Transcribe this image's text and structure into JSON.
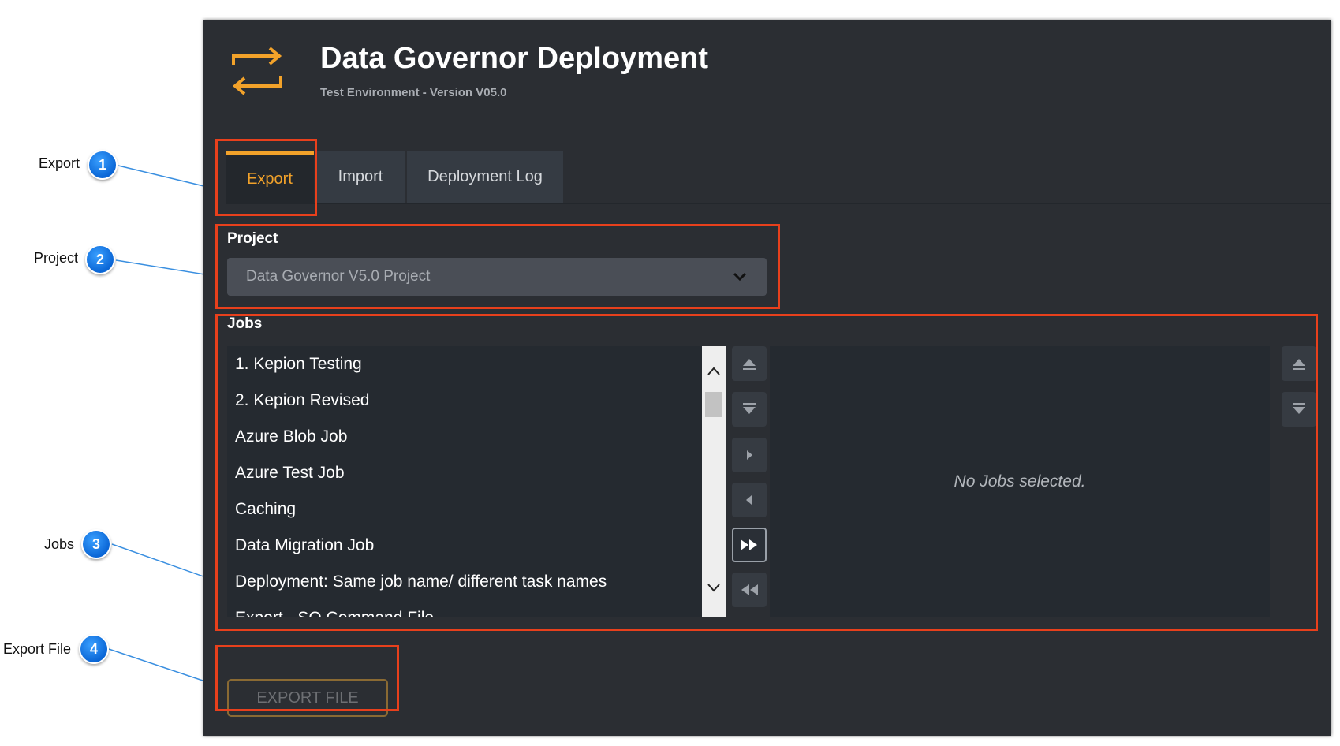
{
  "annotations": [
    {
      "number": "1",
      "label": "Export"
    },
    {
      "number": "2",
      "label": "Project"
    },
    {
      "number": "3",
      "label": "Jobs"
    },
    {
      "number": "4",
      "label": "Export File"
    }
  ],
  "app": {
    "title": "Data Governor Deployment",
    "subtitle": "Test Environment - Version V05.0",
    "logo_icon": "swap-arrows-icon",
    "accent_color": "#f2a22a"
  },
  "tabs": [
    {
      "label": "Export",
      "active": true
    },
    {
      "label": "Import",
      "active": false
    },
    {
      "label": "Deployment Log",
      "active": false
    }
  ],
  "project": {
    "label": "Project",
    "selected": "Data Governor V5.0 Project"
  },
  "jobs": {
    "label": "Jobs",
    "available": [
      "1. Kepion Testing",
      "2. Kepion Revised",
      "Azure Blob Job",
      "Azure Test Job",
      "Caching",
      "Data Migration Job",
      "Deployment: Same job name/ different task names",
      "Export - SQ Command File"
    ],
    "selected_empty_message": "No Jobs selected."
  },
  "export_button": {
    "label": "EXPORT FILE"
  }
}
